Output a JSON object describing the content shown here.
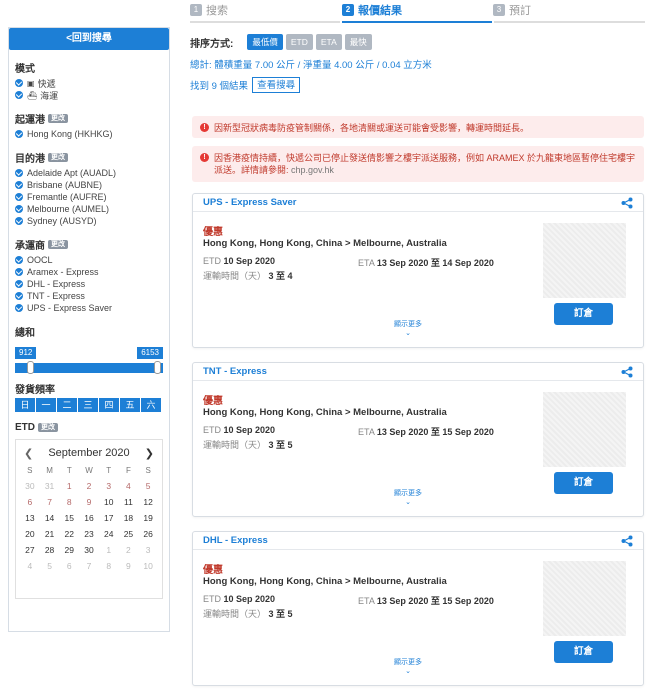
{
  "steps": [
    {
      "num": "1",
      "label": "搜索"
    },
    {
      "num": "2",
      "label": "報價結果"
    },
    {
      "num": "3",
      "label": "預訂"
    }
  ],
  "sidebar": {
    "back_label": "<回到搜尋",
    "mode": {
      "title": "模式",
      "items": [
        "快遞",
        "海運"
      ]
    },
    "origin": {
      "title": "起運港",
      "tag": "更改",
      "items": [
        "Hong Kong (HKHKG)"
      ]
    },
    "destination": {
      "title": "目的港",
      "tag": "更改",
      "items": [
        "Adelaide Apt (AUADL)",
        "Brisbane (AUBNE)",
        "Fremantle (AUFRE)",
        "Melbourne (AUMEL)",
        "Sydney (AUSYD)"
      ]
    },
    "carrier": {
      "title": "承運商",
      "tag": "更改",
      "items": [
        "OOCL",
        "Aramex - Express",
        "DHL - Express",
        "TNT - Express",
        "UPS - Express Saver"
      ]
    },
    "total": {
      "title": "總和",
      "min": "912",
      "max": "6153"
    },
    "frequency": {
      "title": "發貨頻率",
      "days": [
        "日",
        "一",
        "二",
        "三",
        "四",
        "五",
        "六"
      ]
    },
    "etd": {
      "title": "ETD",
      "tag": "更改"
    },
    "calendar": {
      "month": "September 2020",
      "weekdays": [
        "S",
        "M",
        "T",
        "W",
        "T",
        "F",
        "S"
      ],
      "weeks": [
        [
          "30",
          "31",
          "1",
          "2",
          "3",
          "4",
          "5"
        ],
        [
          "6",
          "7",
          "8",
          "9",
          "10",
          "11",
          "12"
        ],
        [
          "13",
          "14",
          "15",
          "16",
          "17",
          "18",
          "19"
        ],
        [
          "20",
          "21",
          "22",
          "23",
          "24",
          "25",
          "26"
        ],
        [
          "27",
          "28",
          "29",
          "30",
          "1",
          "2",
          "3"
        ],
        [
          "4",
          "5",
          "6",
          "7",
          "8",
          "9",
          "10"
        ]
      ]
    }
  },
  "sort": {
    "label": "排序方式:",
    "options": [
      "最低價",
      "ETD",
      "ETA",
      "最快"
    ],
    "selected": "最低價"
  },
  "totals": "總計: 體積重量 7.00 公斤 / 淨重量 4.00 公斤 / 0.04 立方米",
  "found": {
    "text": "找到 9 個結果",
    "button": "查看搜尋"
  },
  "alerts": [
    {
      "text": "因新型冠狀病毒防疫管制關係，各地清關或運送可能會受影響，轉運時間延長。"
    },
    {
      "text": "因香港疫情持續，快遞公司已停止發送倩影響之樓宇派送服務，例如 ARAMEX 於九龍東地區暫停住宅樓宇派送。詳情請參閱:",
      "link": "chp.gov.hk"
    }
  ],
  "results": [
    {
      "carrier": "UPS - Express Saver",
      "promo": "優惠",
      "route": "Hong Kong, Hong Kong, China > Melbourne, Australia",
      "etd_label": "ETD",
      "etd": "10 Sep 2020",
      "eta_label": "ETA",
      "eta": "13 Sep 2020 至 14 Sep 2020",
      "transit_label": "運輸時間（天）",
      "transit": "3 至 4",
      "more": "顯示更多",
      "book": "訂倉"
    },
    {
      "carrier": "TNT - Express",
      "promo": "優惠",
      "route": "Hong Kong, Hong Kong, China > Melbourne, Australia",
      "etd_label": "ETD",
      "etd": "10 Sep 2020",
      "eta_label": "ETA",
      "eta": "13 Sep 2020 至 15 Sep 2020",
      "transit_label": "運輸時間（天）",
      "transit": "3 至 5",
      "more": "顯示更多",
      "book": "訂倉"
    },
    {
      "carrier": "DHL - Express",
      "promo": "優惠",
      "route": "Hong Kong, Hong Kong, China > Melbourne, Australia",
      "etd_label": "ETD",
      "etd": "10 Sep 2020",
      "eta_label": "ETA",
      "eta": "13 Sep 2020 至 15 Sep 2020",
      "transit_label": "運輸時間（天）",
      "transit": "3 至 5",
      "more": "顯示更多",
      "book": "訂倉"
    }
  ],
  "colors": {
    "accent": "#1d7fd6",
    "alert_bg": "#fdecec",
    "alert_text": "#c0392b"
  }
}
